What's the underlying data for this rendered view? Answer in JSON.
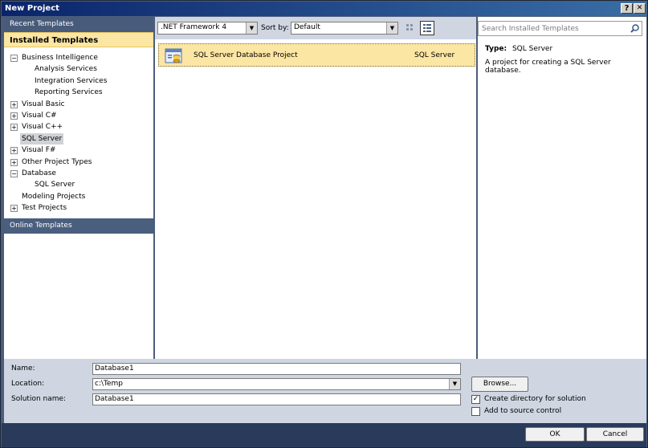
{
  "window": {
    "title": "New Project",
    "help_label": "?",
    "close_label": "✕"
  },
  "left": {
    "recent_templates": "Recent Templates",
    "installed_templates": "Installed Templates",
    "online_templates": "Online Templates",
    "tree": [
      {
        "label": "Business Intelligence",
        "level": 0,
        "expander": "−"
      },
      {
        "label": "Analysis Services",
        "level": 1
      },
      {
        "label": "Integration Services",
        "level": 1
      },
      {
        "label": "Reporting Services",
        "level": 1
      },
      {
        "label": "Visual Basic",
        "level": 0,
        "expander": "+"
      },
      {
        "label": "Visual C#",
        "level": 0,
        "expander": "+"
      },
      {
        "label": "Visual C++",
        "level": 0,
        "expander": "+"
      },
      {
        "label": "SQL Server",
        "level": 0,
        "selected": true
      },
      {
        "label": "Visual F#",
        "level": 0,
        "expander": "+"
      },
      {
        "label": "Other Project Types",
        "level": 0,
        "expander": "+"
      },
      {
        "label": "Database",
        "level": 0,
        "expander": "−"
      },
      {
        "label": "SQL Server",
        "level": 1
      },
      {
        "label": "Modeling Projects",
        "level": 0
      },
      {
        "label": "Test Projects",
        "level": 0,
        "expander": "+"
      }
    ]
  },
  "toolbar": {
    "framework": ".NET Framework 4",
    "sort_label": "Sort by:",
    "sort_value": "Default"
  },
  "templates": [
    {
      "name": "SQL Server Database Project",
      "type": "SQL Server"
    }
  ],
  "details": {
    "search_placeholder": "Search Installed Templates",
    "type_label": "Type:",
    "type_value": "SQL Server",
    "description": "A project for creating a SQL Server database."
  },
  "form": {
    "name_label": "Name:",
    "name_value": "Database1",
    "location_label": "Location:",
    "location_value": "c:\\Temp",
    "solution_label": "Solution name:",
    "solution_value": "Database1",
    "browse_label": "Browse...",
    "create_dir_label": "Create directory for solution",
    "create_dir_checked": true,
    "source_control_label": "Add to source control",
    "source_control_checked": false
  },
  "footer": {
    "ok_label": "OK",
    "cancel_label": "Cancel"
  }
}
